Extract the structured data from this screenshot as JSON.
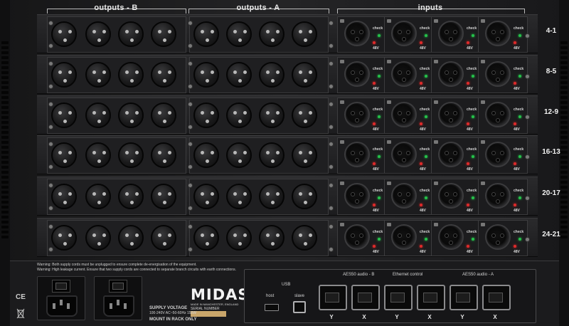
{
  "headers": {
    "outputs_b": "outputs - B",
    "outputs_a": "outputs - A",
    "inputs": "inputs"
  },
  "rows": [
    {
      "label": "4-1"
    },
    {
      "label": "8-5"
    },
    {
      "label": "12-9"
    },
    {
      "label": "16-13"
    },
    {
      "label": "20-17"
    },
    {
      "label": "24-21"
    }
  ],
  "input_labels": {
    "check": "check",
    "phantom": "48V"
  },
  "warnings": {
    "line1": "Warning: Both supply cords must be unplugged to ensure complete de-energisation of the equipment.",
    "line2": "Warning: High leakage current.  Ensure that two supply cords are connected to separate branch circuits with earth connections."
  },
  "brand": {
    "logo": "MIDAS",
    "made_in": "MADE IN MANCHESTER, ENGLAND",
    "serial_label": "SERIAL NUMBER"
  },
  "power": {
    "supply_voltage": "SUPPLY VOLTAGE",
    "rating": "100-240V  AC~50-60Hz 150W",
    "mount": "MOUNT IN RACK ONLY"
  },
  "usb": {
    "title": "USB",
    "host": "host",
    "slave": "slave"
  },
  "network": {
    "aes50_b": "AES50 audio - B",
    "ethernet": "Ethernet control",
    "aes50_a": "AES50 audio - A",
    "ports": [
      "Y",
      "X",
      "Y",
      "X",
      "Y",
      "X"
    ]
  },
  "colors": {
    "led_green": "#25c24a",
    "led_red": "#e02a2a"
  }
}
